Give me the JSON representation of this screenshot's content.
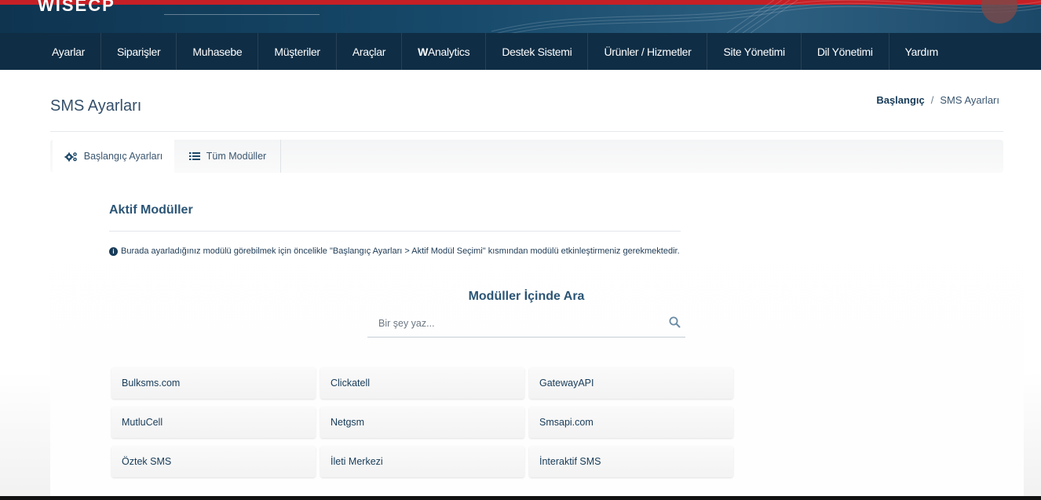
{
  "header": {
    "logo_text": "WISECP"
  },
  "nav": {
    "items": [
      {
        "label": "Ayarlar"
      },
      {
        "label": "Siparişler"
      },
      {
        "label": "Muhasebe"
      },
      {
        "label": "Müşteriler"
      },
      {
        "label": "Araçlar"
      },
      {
        "label_bold": "W",
        "label_rest": "Analytics"
      },
      {
        "label": "Destek Sistemi"
      },
      {
        "label": "Ürünler / Hizmetler"
      },
      {
        "label": "Site Yönetimi"
      },
      {
        "label": "Dil Yönetimi"
      },
      {
        "label": "Yardım"
      }
    ]
  },
  "page": {
    "title": "SMS Ayarları",
    "breadcrumb": {
      "home": "Başlangıç",
      "separator": "/",
      "current": "SMS Ayarları"
    }
  },
  "tabs": [
    {
      "label": "Başlangıç Ayarları",
      "icon": "gears-icon",
      "active": true
    },
    {
      "label": "Tüm Modüller",
      "icon": "list-icon",
      "active": false
    }
  ],
  "section": {
    "title": "Aktif Modüller",
    "info_text": "Burada ayarladığınız modülü görebilmek için öncelikle \"Başlangıç Ayarları > Aktif Modül Seçimi\" kısmından modülü etkinleştirmeniz gerekmektedir."
  },
  "search": {
    "title": "Modüller İçinde Ara",
    "placeholder": "Bir şey yaz..."
  },
  "modules": [
    "Bulksms.com",
    "Clickatell",
    "GatewayAPI",
    "MutluCell",
    "Netgsm",
    "Smsapi.com",
    "Öztek SMS",
    "İleti Merkezi",
    "İnteraktif SMS"
  ],
  "colors": {
    "nav_bg": "#0f2d45",
    "accent_red": "#c62026",
    "title_blue": "#2b5576"
  }
}
